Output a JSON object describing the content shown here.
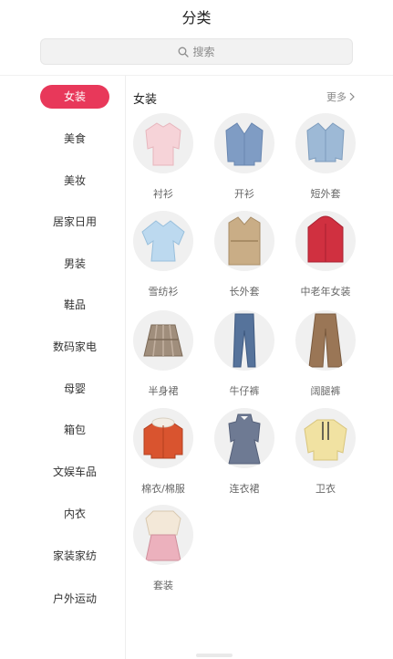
{
  "header": {
    "title": "分类"
  },
  "search": {
    "placeholder": "搜索",
    "icon": "search-icon"
  },
  "sidebar": {
    "active_color": "#e8385a",
    "items": [
      {
        "label": "女装",
        "active": true
      },
      {
        "label": "美食"
      },
      {
        "label": "美妆"
      },
      {
        "label": "居家日用"
      },
      {
        "label": "男装"
      },
      {
        "label": "鞋品"
      },
      {
        "label": "数码家电"
      },
      {
        "label": "母婴"
      },
      {
        "label": "箱包"
      },
      {
        "label": "文娱车品"
      },
      {
        "label": "内衣"
      },
      {
        "label": "家装家纺"
      },
      {
        "label": "户外运动"
      }
    ]
  },
  "main": {
    "section_title": "女装",
    "more_label": "更多",
    "categories": [
      {
        "label": "衬衫",
        "icon": "blouse-icon",
        "color": "#f6d3d8"
      },
      {
        "label": "开衫",
        "icon": "cardigan-icon",
        "color": "#7f9cc4"
      },
      {
        "label": "短外套",
        "icon": "denim-jacket-icon",
        "color": "#9db9d6"
      },
      {
        "label": "雪纺衫",
        "icon": "chiffon-top-icon",
        "color": "#bcd9ef"
      },
      {
        "label": "长外套",
        "icon": "trench-coat-icon",
        "color": "#c9ad86"
      },
      {
        "label": "中老年女装",
        "icon": "red-coat-icon",
        "color": "#d03040"
      },
      {
        "label": "半身裙",
        "icon": "plaid-skirt-icon",
        "color": "#a08e7c"
      },
      {
        "label": "牛仔裤",
        "icon": "jeans-icon",
        "color": "#56739b"
      },
      {
        "label": "阔腿裤",
        "icon": "wide-pants-icon",
        "color": "#9a7656"
      },
      {
        "label": "棉衣/棉服",
        "icon": "padded-jacket-icon",
        "color": "#d9542f"
      },
      {
        "label": "连衣裙",
        "icon": "dress-icon",
        "color": "#6e7a93"
      },
      {
        "label": "卫衣",
        "icon": "hoodie-icon",
        "color": "#f1e2a2"
      },
      {
        "label": "套装",
        "icon": "outfit-set-icon",
        "color": "#ecb1bd"
      }
    ]
  }
}
